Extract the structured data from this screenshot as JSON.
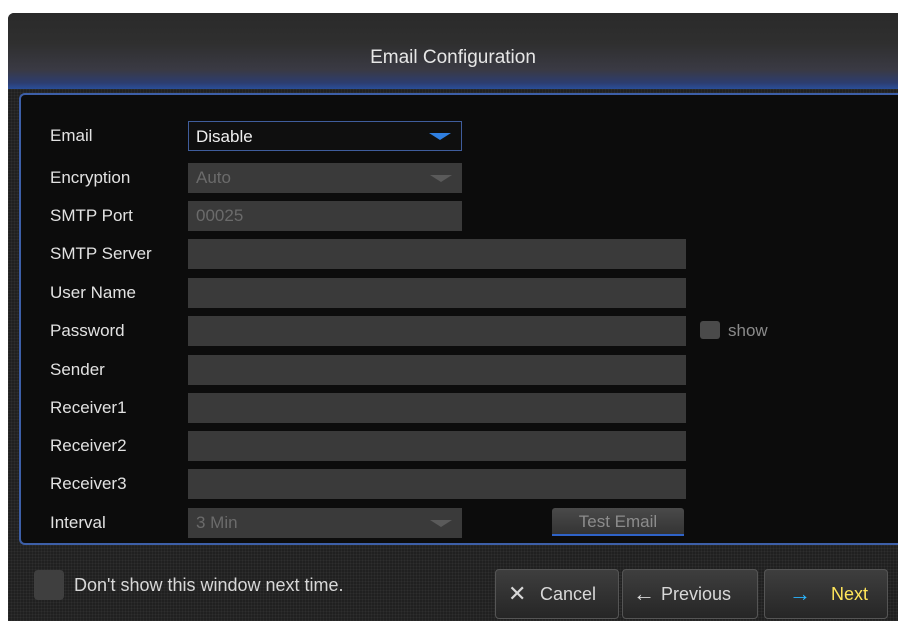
{
  "window": {
    "title": "Email Configuration"
  },
  "form": {
    "email": {
      "label": "Email",
      "value": "Disable"
    },
    "encryption": {
      "label": "Encryption",
      "value": "Auto"
    },
    "smtp_port": {
      "label": "SMTP Port",
      "value": "00025"
    },
    "smtp_server": {
      "label": "SMTP Server",
      "value": ""
    },
    "user_name": {
      "label": "User Name",
      "value": ""
    },
    "password": {
      "label": "Password",
      "value": "",
      "show_label": "show"
    },
    "sender": {
      "label": "Sender",
      "value": ""
    },
    "receiver1": {
      "label": "Receiver1",
      "value": ""
    },
    "receiver2": {
      "label": "Receiver2",
      "value": ""
    },
    "receiver3": {
      "label": "Receiver3",
      "value": ""
    },
    "interval": {
      "label": "Interval",
      "value": "3 Min"
    },
    "test_email_label": "Test Email"
  },
  "footer": {
    "dont_show_label": "Don't show this window next time.",
    "cancel_label": "Cancel",
    "previous_label": "Previous",
    "next_label": "Next",
    "cancel_icon": "close-icon",
    "previous_icon": "arrow-left-icon",
    "next_icon": "arrow-right-icon"
  },
  "colors": {
    "accent": "#2f7fe0",
    "panel_border": "#3d5fa8",
    "next_text": "#ffe65a",
    "next_arrow": "#29b6ff"
  }
}
